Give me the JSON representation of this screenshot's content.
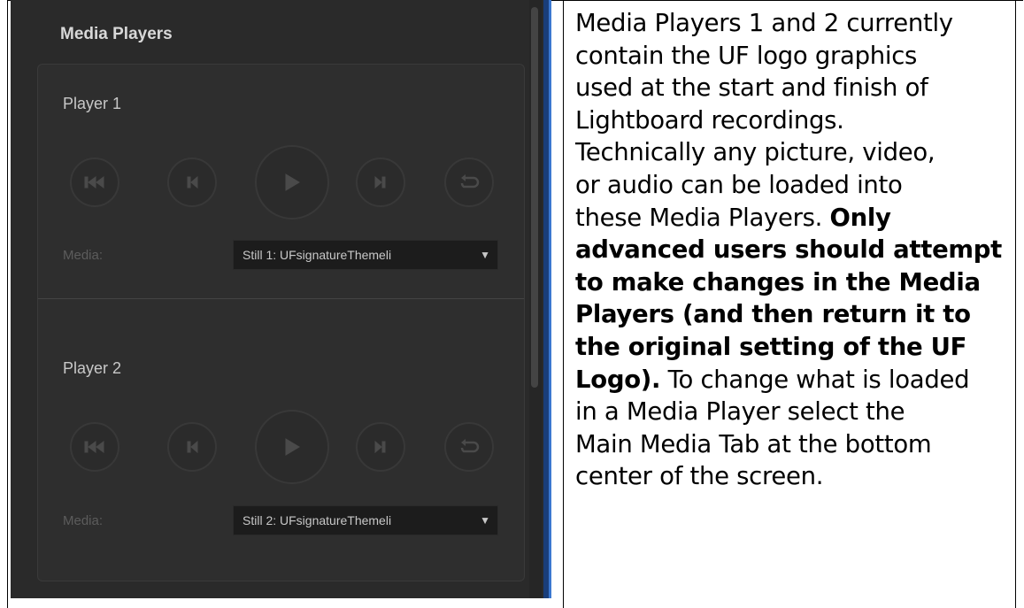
{
  "ui": {
    "panel_title": "Media Players",
    "players": [
      {
        "title": "Player 1",
        "media_label": "Media:",
        "media_value": "Still 1: UFsignatureThemeli"
      },
      {
        "title": "Player 2",
        "media_label": "Media:",
        "media_value": "Still 2: UFsignatureThemeli"
      }
    ],
    "icons": [
      "skip-to-start-icon",
      "previous-frame-icon",
      "play-icon",
      "next-frame-icon",
      "loop-icon",
      "dropdown-caret-icon"
    ],
    "colors": {
      "panel_bg": "#2a2a2a",
      "card_bg": "#2e2e2e",
      "accent_bar": "#3b78d0"
    }
  },
  "doc": {
    "lines": [
      {
        "parts": [
          {
            "text": "Media Players 1 and 2 currently",
            "bold": false
          }
        ]
      },
      {
        "parts": [
          {
            "text": "contain the UF logo graphics",
            "bold": false
          }
        ]
      },
      {
        "parts": [
          {
            "text": "used at the start and finish of",
            "bold": false
          }
        ]
      },
      {
        "parts": [
          {
            "text": "Lightboard recordings.",
            "bold": false
          }
        ]
      },
      {
        "parts": [
          {
            "text": "Technically any picture, video,",
            "bold": false
          }
        ]
      },
      {
        "parts": [
          {
            "text": "or audio can be loaded into",
            "bold": false
          }
        ]
      },
      {
        "parts": [
          {
            "text": "these Media Players. ",
            "bold": false
          },
          {
            "text": "Only",
            "bold": true
          }
        ]
      },
      {
        "parts": [
          {
            "text": "advanced users should attempt",
            "bold": true
          }
        ]
      },
      {
        "parts": [
          {
            "text": "to make changes in the Media",
            "bold": true
          }
        ]
      },
      {
        "parts": [
          {
            "text": "Players (and then return it to",
            "bold": true
          }
        ]
      },
      {
        "parts": [
          {
            "text": "the original setting of the UF",
            "bold": true
          }
        ]
      },
      {
        "parts": [
          {
            "text": "Logo).",
            "bold": true
          },
          {
            "text": " To change what is loaded",
            "bold": false
          }
        ]
      },
      {
        "parts": [
          {
            "text": "in a Media Player select the",
            "bold": false
          }
        ]
      },
      {
        "parts": [
          {
            "text": "Main Media Tab at the bottom",
            "bold": false
          }
        ]
      },
      {
        "parts": [
          {
            "text": "center of the screen.",
            "bold": false
          }
        ]
      }
    ]
  }
}
